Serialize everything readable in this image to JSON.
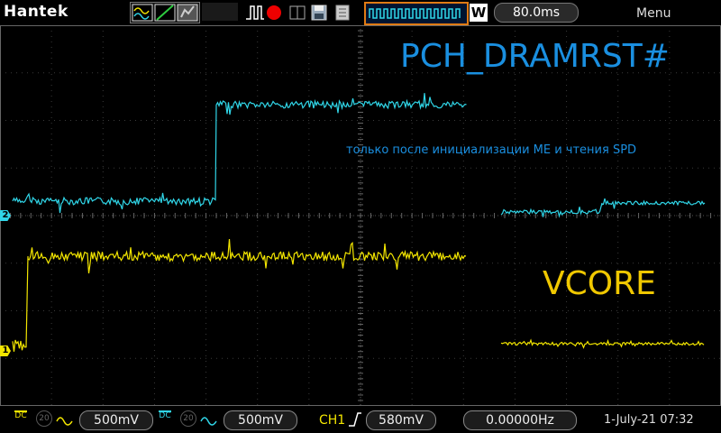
{
  "top": {
    "brand": "Hantek",
    "timebase": "80.0ms",
    "menu": "Menu",
    "icons": [
      "waveform-mode-icon",
      "line-mode-icon",
      "persistence-icon",
      "trigger-pulse-icon",
      "record-icon",
      "save-icon",
      "print-icon",
      "trigger-position-icon"
    ]
  },
  "annotations": {
    "signal_top": "PCH_DRAMRST#",
    "note": "только после инициализации ME и чтения SPD",
    "signal_bottom": "VCORE"
  },
  "markers": {
    "ch1": "1",
    "ch2": "2"
  },
  "bottom": {
    "ch1_coupling": "DC",
    "ch1_bw": "20",
    "ch1_scale": "500mV",
    "ch2_coupling": "DC",
    "ch2_bw": "20",
    "ch2_scale": "500mV",
    "trigger_source": "CH1",
    "trigger_level": "580mV",
    "frequency": "0.00000Hz",
    "datetime": "1-July-21 07:32"
  },
  "colors": {
    "ch1": "#f3e600",
    "ch2": "#30d6e8",
    "annotation": "#1a8fe0",
    "vcore_label": "#f0c800",
    "grid": "#3a3a3a"
  }
}
